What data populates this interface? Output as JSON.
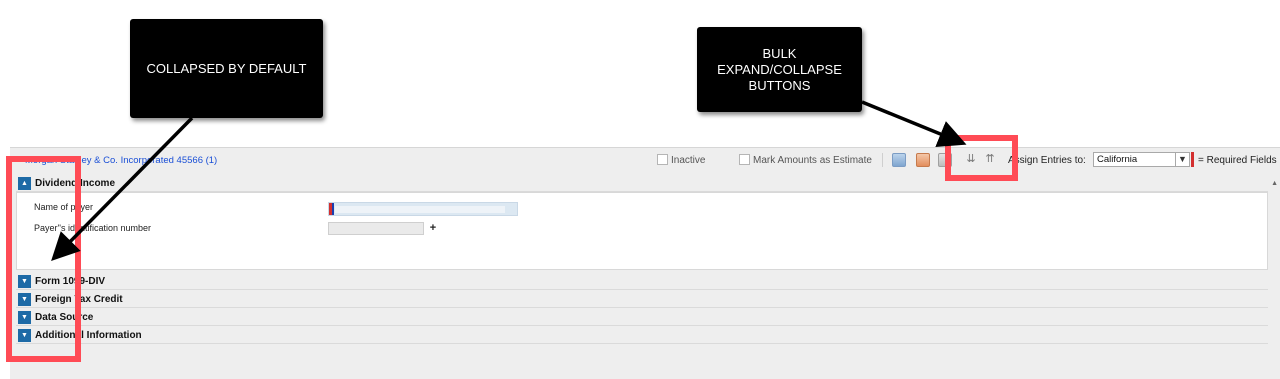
{
  "callouts": {
    "collapsed": "COLLAPSED BY DEFAULT",
    "bulk": "BULK EXPAND/COLLAPSE BUTTONS"
  },
  "toolbar": {
    "account_link": "Morgan Stanley & Co. Incorporated 45566 (1)",
    "inactive_label": "Inactive",
    "mark_amounts_label": "Mark Amounts as Estimate",
    "assign_label": "Assign Entries to:",
    "assign_value": "California",
    "required_label": "= Required Fields"
  },
  "sections": [
    {
      "label": "Dividend Income",
      "expanded": true
    },
    {
      "label": "Form 1099-DIV",
      "expanded": false
    },
    {
      "label": "Foreign Tax Credit",
      "expanded": false
    },
    {
      "label": "Data Source",
      "expanded": false
    },
    {
      "label": "Additional Information",
      "expanded": false
    }
  ],
  "fields": {
    "payer_name_label": "Name of payer",
    "payer_id_label": "Payer''s identification number",
    "add_symbol": "+"
  },
  "icons": [
    "export-icon",
    "import-icon",
    "delete-icon",
    "expand-all-icon",
    "collapse-all-icon"
  ],
  "colors": {
    "accent_blue": "#1d6aa6",
    "link_blue": "#1a4fd6",
    "highlight_red": "#ff4b55",
    "required_red": "#d32f2f"
  }
}
